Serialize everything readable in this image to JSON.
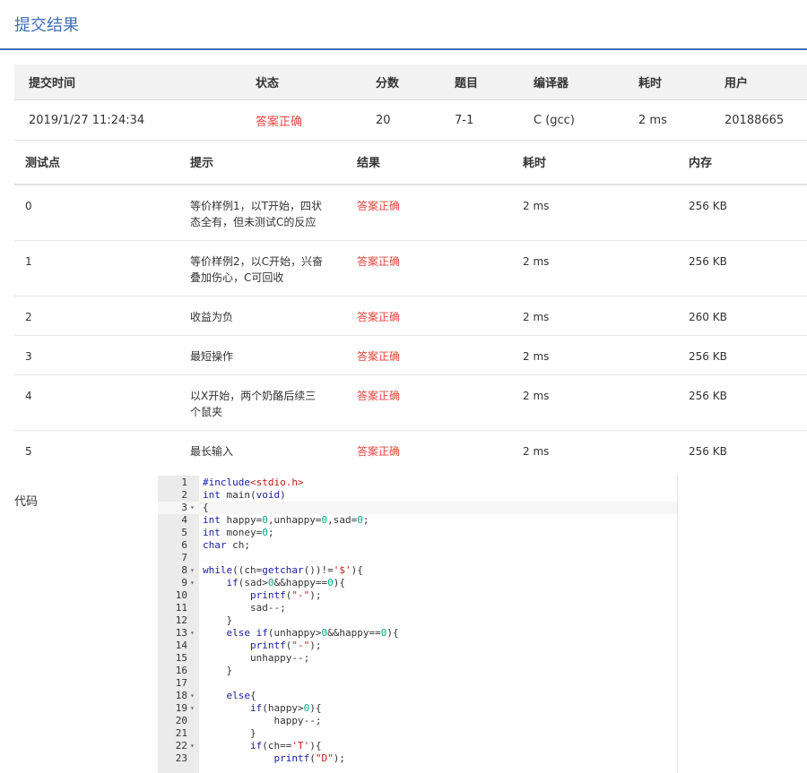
{
  "page": {
    "title": "提交结果"
  },
  "summary": {
    "headers": [
      "提交时间",
      "状态",
      "分数",
      "题目",
      "编译器",
      "耗时",
      "用户"
    ],
    "row": [
      "2019/1/27 11:24:34",
      "答案正确",
      "20",
      "7-1",
      "C (gcc)",
      "2 ms",
      "20188665"
    ]
  },
  "cases": {
    "headers": [
      "测试点",
      "提示",
      "结果",
      "耗时",
      "内存"
    ],
    "rows": [
      {
        "id": "0",
        "hint": "等价样例1，以T开始，四状态全有，但未测试C的反应",
        "result": "答案正确",
        "time": "2 ms",
        "mem": "256 KB"
      },
      {
        "id": "1",
        "hint": "等价样例2，以C开始，兴奋叠加伤心，C可回收",
        "result": "答案正确",
        "time": "2 ms",
        "mem": "256 KB"
      },
      {
        "id": "2",
        "hint": "收益为负",
        "result": "答案正确",
        "time": "2 ms",
        "mem": "260 KB"
      },
      {
        "id": "3",
        "hint": "最短操作",
        "result": "答案正确",
        "time": "2 ms",
        "mem": "256 KB"
      },
      {
        "id": "4",
        "hint": "以X开始，两个奶酪后续三个鼠夹",
        "result": "答案正确",
        "time": "2 ms",
        "mem": "256 KB"
      },
      {
        "id": "5",
        "hint": "最长输入",
        "result": "答案正确",
        "time": "2 ms",
        "mem": "256 KB"
      }
    ]
  },
  "code": {
    "label": "代码",
    "lines": [
      {
        "n": "1",
        "fold": false,
        "text": "#include<stdio.h>"
      },
      {
        "n": "2",
        "fold": false,
        "text": "int main(void)"
      },
      {
        "n": "3",
        "fold": true,
        "text": "{"
      },
      {
        "n": "4",
        "fold": false,
        "text": "int happy=0,unhappy=0,sad=0;"
      },
      {
        "n": "5",
        "fold": false,
        "text": "int money=0;"
      },
      {
        "n": "6",
        "fold": false,
        "text": "char ch;"
      },
      {
        "n": "7",
        "fold": false,
        "text": ""
      },
      {
        "n": "8",
        "fold": true,
        "text": "while((ch=getchar())!='$'){"
      },
      {
        "n": "9",
        "fold": true,
        "text": "    if(sad>0&&happy==0){"
      },
      {
        "n": "10",
        "fold": false,
        "text": "        printf(\"-\");"
      },
      {
        "n": "11",
        "fold": false,
        "text": "        sad--;"
      },
      {
        "n": "12",
        "fold": false,
        "text": "    }"
      },
      {
        "n": "13",
        "fold": true,
        "text": "    else if(unhappy>0&&happy==0){"
      },
      {
        "n": "14",
        "fold": false,
        "text": "        printf(\"-\");"
      },
      {
        "n": "15",
        "fold": false,
        "text": "        unhappy--;"
      },
      {
        "n": "16",
        "fold": false,
        "text": "    }"
      },
      {
        "n": "17",
        "fold": false,
        "text": ""
      },
      {
        "n": "18",
        "fold": true,
        "text": "    else{"
      },
      {
        "n": "19",
        "fold": true,
        "text": "        if(happy>0){"
      },
      {
        "n": "20",
        "fold": false,
        "text": "            happy--;"
      },
      {
        "n": "21",
        "fold": false,
        "text": "        }"
      },
      {
        "n": "22",
        "fold": true,
        "text": "        if(ch=='T'){"
      },
      {
        "n": "23",
        "fold": false,
        "text": "            printf(\"D\");"
      }
    ]
  },
  "colors": {
    "accent": "#3f6fb6",
    "success_text": "#e64640"
  }
}
